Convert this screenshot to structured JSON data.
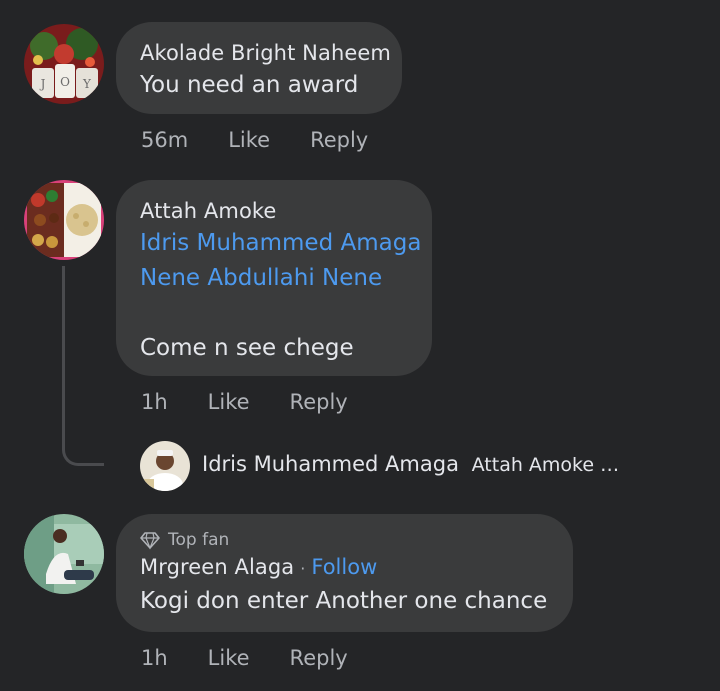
{
  "comments": [
    {
      "author": "Akolade Bright Naheem",
      "lines": [
        "You need an award"
      ],
      "time": "56m",
      "like": "Like",
      "reply": "Reply"
    },
    {
      "author": "Attah Amoke",
      "mentions": [
        "Idris Muhammed Amaga",
        "Nene Abdullahi Nene"
      ],
      "lines": [
        "Come n see chege"
      ],
      "time": "1h",
      "like": "Like",
      "reply": "Reply",
      "reply_preview": {
        "author": "Idris Muhammed Amaga",
        "text": "Attah Amoke …"
      }
    },
    {
      "badge": "Top fan",
      "author": "Mrgreen Alaga",
      "separator": "·",
      "follow": "Follow",
      "lines": [
        "Kogi don enter Another one chance"
      ],
      "time": "1h",
      "like": "Like",
      "reply": "Reply"
    }
  ],
  "colors": {
    "background": "#242527",
    "bubble": "#3a3b3c",
    "link": "#4d9aef",
    "secondary_text": "#b0b3b8"
  }
}
